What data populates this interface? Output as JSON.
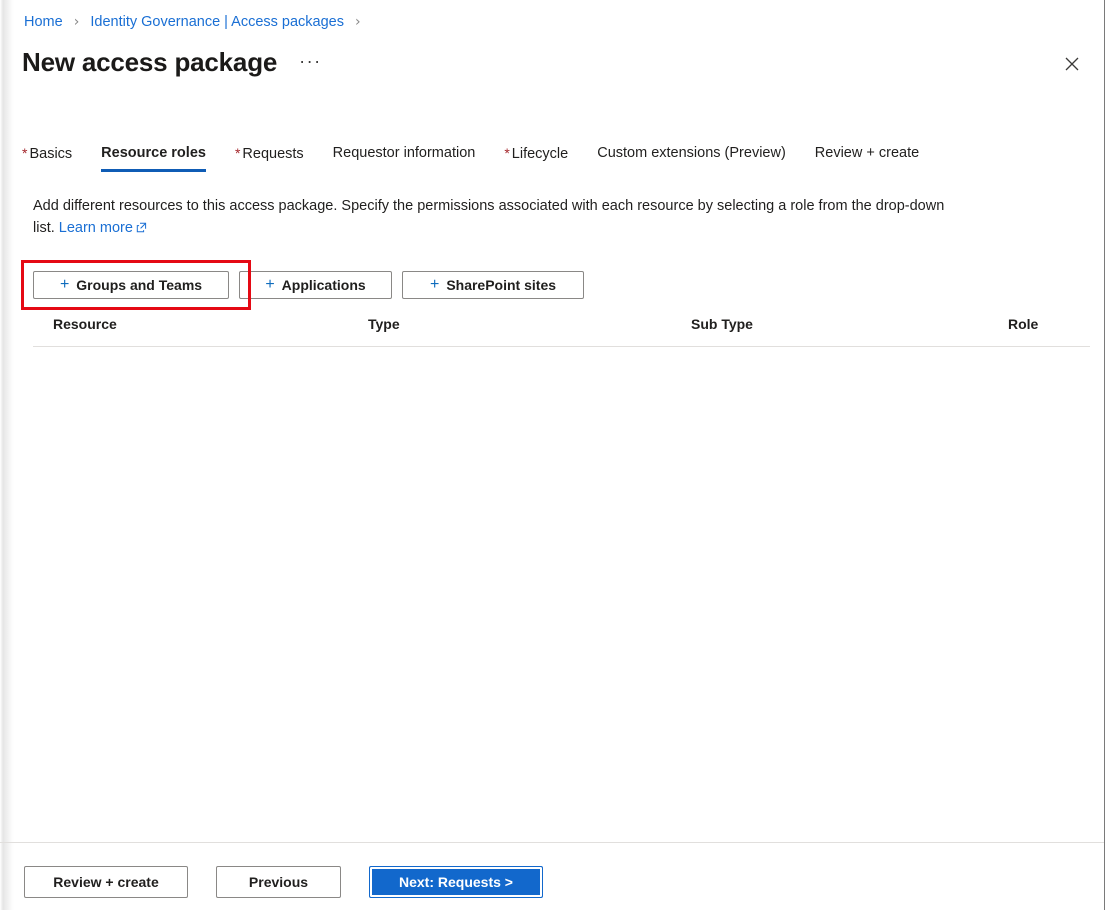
{
  "breadcrumb": {
    "items": [
      {
        "label": "Home",
        "separator": "›"
      },
      {
        "label": "Identity Governance | Access packages",
        "separator": "›"
      }
    ],
    "home_label": "Home",
    "home_separator": "›",
    "governance_label": "Identity Governance | Access packages",
    "governance_separator": "›"
  },
  "header": {
    "title": "New access package",
    "more_menu": "···",
    "close_label": "Close"
  },
  "tabs": [
    {
      "label": "Basics",
      "required": true,
      "selected": false
    },
    {
      "label": "Resource roles",
      "required": false,
      "selected": true
    },
    {
      "label": "Requests",
      "required": true,
      "selected": false
    },
    {
      "label": "Requestor information",
      "required": false,
      "selected": false
    },
    {
      "label": "Lifecycle",
      "required": true,
      "selected": false
    },
    {
      "label": "Custom extensions (Preview)",
      "required": false,
      "selected": false
    },
    {
      "label": "Review + create",
      "required": false,
      "selected": false
    }
  ],
  "description": {
    "text": "Add different resources to this access package. Specify the permissions associated with each resource by selecting a role from the drop-down list.",
    "link_label": "Learn more",
    "link_icon": "external-link-icon"
  },
  "add_buttons": [
    {
      "label": "Groups and Teams",
      "icon": "plus-icon",
      "highlighted": true
    },
    {
      "label": "Applications",
      "icon": "plus-icon",
      "highlighted": false
    },
    {
      "label": "SharePoint sites",
      "icon": "plus-icon",
      "highlighted": false
    }
  ],
  "table": {
    "columns": [
      "Resource",
      "Type",
      "Sub Type",
      "Role"
    ],
    "rows": []
  },
  "footer": {
    "review_label": "Review + create",
    "previous_label": "Previous",
    "next_label": "Next: Requests >"
  },
  "colors": {
    "link_blue": "#1a6fd4",
    "tab_underline": "#0f5cb5",
    "required_star": "#a4262c",
    "primary_button": "#1268cc",
    "annotation_red": "#e50914",
    "plus_blue": "#0f6cbd",
    "text_primary": "#201f1e",
    "divider": "#e1dfdd"
  }
}
